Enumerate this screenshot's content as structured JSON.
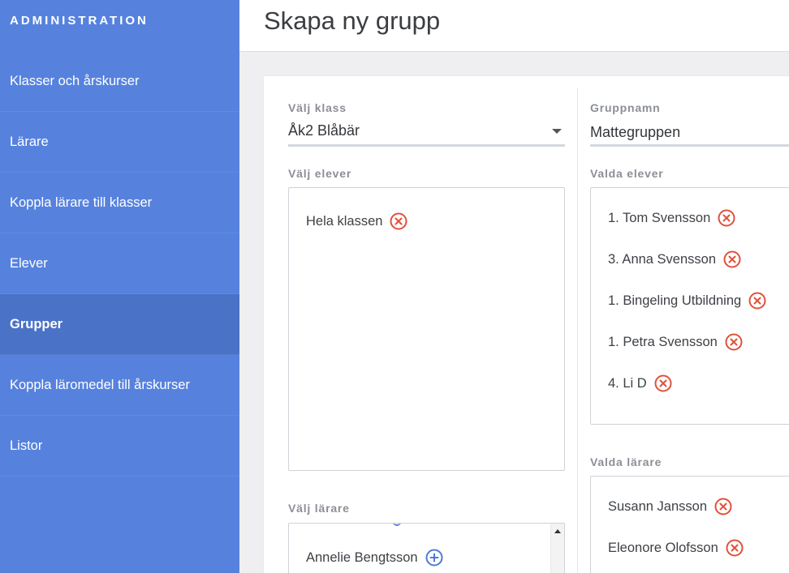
{
  "sidebar": {
    "header": "ADMINISTRATION",
    "items": [
      {
        "label": "Klasser och årskurser"
      },
      {
        "label": "Lärare"
      },
      {
        "label": "Koppla lärare till klasser"
      },
      {
        "label": "Elever"
      },
      {
        "label": "Grupper"
      },
      {
        "label": "Koppla läromedel till årskurser"
      },
      {
        "label": "Listor"
      }
    ],
    "active_item": "Grupper"
  },
  "page": {
    "title": "Skapa ny grupp"
  },
  "form": {
    "class_select": {
      "label": "Välj klass",
      "value": "Åk2 Blåbär"
    },
    "group_name": {
      "label": "Gruppnamn",
      "value": "Mattegruppen"
    },
    "choose_students": {
      "label": "Välj elever",
      "items": [
        {
          "label": "Hela klassen",
          "action": "remove"
        }
      ]
    },
    "selected_students": {
      "label": "Valda elever",
      "items": [
        {
          "label": "1. Tom Svensson",
          "action": "remove"
        },
        {
          "label": "3. Anna Svensson",
          "action": "remove"
        },
        {
          "label": "1. Bingeling Utbildning",
          "action": "remove"
        },
        {
          "label": "1. Petra Svensson",
          "action": "remove"
        },
        {
          "label": "4. Li D",
          "action": "remove"
        }
      ]
    },
    "choose_teachers": {
      "label": "Välj lärare",
      "items": [
        {
          "label": "Annelie Bengtsson",
          "action": "add"
        }
      ]
    },
    "selected_teachers": {
      "label": "Valda lärare",
      "items": [
        {
          "label": "Susann Jansson",
          "action": "remove"
        },
        {
          "label": "Eleonore Olofsson",
          "action": "remove"
        }
      ]
    }
  },
  "colors": {
    "sidebar_bg": "#5682de",
    "sidebar_active_bg": "#4a72c7",
    "remove_icon": "#e0513a",
    "add_icon": "#4d7ad8"
  },
  "icons": {
    "remove": "circle-x-icon",
    "add": "circle-plus-icon",
    "dropdown": "caret-down-icon"
  }
}
